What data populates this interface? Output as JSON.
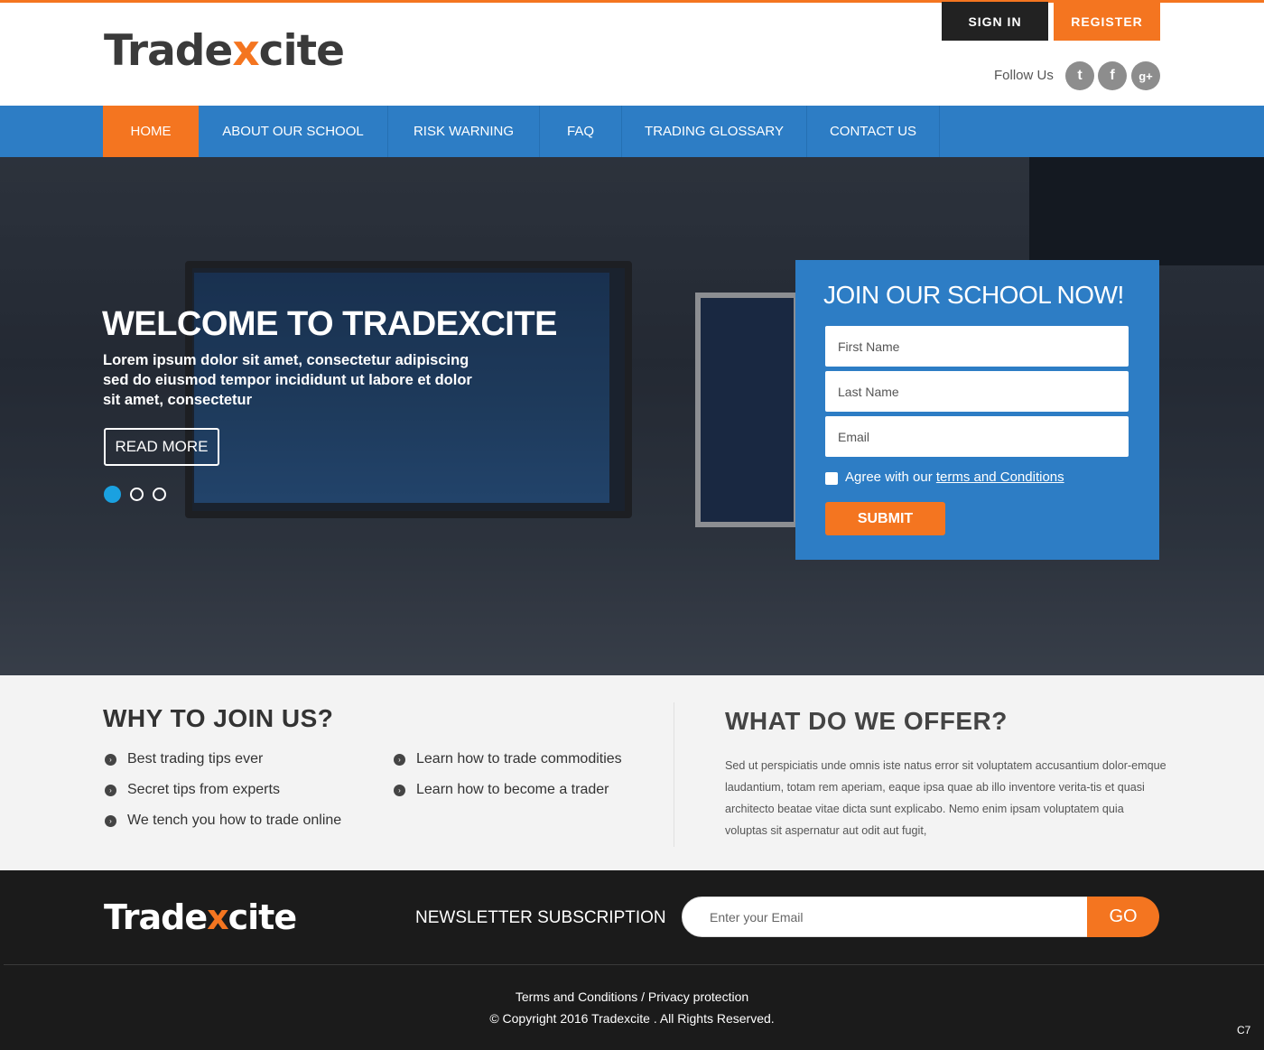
{
  "brand": {
    "part1": "Trade",
    "x": "x",
    "part2": "cite"
  },
  "header": {
    "signin": "SIGN IN",
    "register": "REGISTER",
    "follow": "Follow Us",
    "social": [
      "t",
      "f",
      "g+"
    ]
  },
  "nav": [
    "HOME",
    "ABOUT OUR SCHOOL",
    "RISK WARNING",
    "FAQ",
    "TRADING GLOSSARY",
    "CONTACT US"
  ],
  "hero": {
    "title": "WELCOME TO TRADEXCITE",
    "text": "Lorem ipsum dolor sit amet, consectetur adipiscing sed do eiusmod tempor incididunt ut labore et dolor sit amet, consectetur",
    "button": "READ MORE"
  },
  "join": {
    "title": "JOIN OUR SCHOOL NOW!",
    "first": "First Name",
    "last": "Last Name",
    "email": "Email",
    "agree_prefix": "Agree with our ",
    "agree_link": "terms and Conditions",
    "submit": "SUBMIT"
  },
  "why": {
    "title": "WHY TO JOIN US?",
    "items": [
      "Best trading tips ever",
      "Secret tips from experts",
      "We tench you how to trade online",
      "Learn how to trade commodities",
      "Learn how to become a trader"
    ]
  },
  "offer": {
    "title": "WHAT DO WE OFFER?",
    "text": "Sed ut perspiciatis unde omnis iste natus error sit voluptatem accusantium dolor-emque laudantium, totam rem aperiam, eaque ipsa quae ab illo inventore verita-tis et quasi architecto beatae vitae dicta sunt explicabo. Nemo enim ipsam voluptatem quia voluptas sit aspernatur aut odit aut fugit,"
  },
  "footer": {
    "newsletter": "NEWSLETTER SUBSCRIPTION",
    "email_placeholder": "Enter your Email",
    "go": "GO",
    "links": "Terms and Conditions / Privacy protection",
    "copyright": "© Copyright 2016 Tradexcite  . All Rights Reserved.",
    "badge": "C7"
  },
  "colors": {
    "accent": "#f47520",
    "primary": "#2d7dc5",
    "dark": "#1b1b1b"
  }
}
